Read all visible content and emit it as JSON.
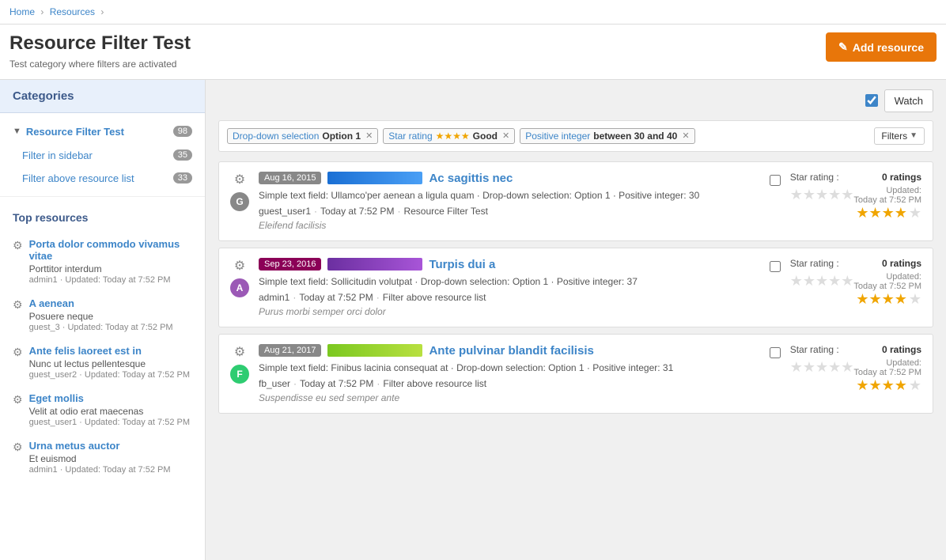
{
  "breadcrumb": {
    "home": "Home",
    "resources": "Resources",
    "current": ""
  },
  "page": {
    "title": "Resource Filter Test",
    "subtitle": "Test category where filters are activated",
    "add_resource_label": "Add resource"
  },
  "watch": {
    "label": "Watch"
  },
  "filters": {
    "label": "Filters",
    "tags": [
      {
        "key": "Drop-down selection",
        "value": "Option 1"
      },
      {
        "key": "Star rating",
        "value": "Good"
      },
      {
        "key": "Positive integer",
        "value": "between 30 and 40"
      }
    ]
  },
  "sidebar": {
    "categories_header": "Categories",
    "section": {
      "title": "Resource Filter Test",
      "count": 98
    },
    "items": [
      {
        "label": "Filter in sidebar",
        "count": 35
      },
      {
        "label": "Filter above resource list",
        "count": 33
      }
    ],
    "top_resources_header": "Top resources",
    "top_resources": [
      {
        "title": "Porta dolor commodo vivamus vitae",
        "subtitle": "Porttitor interdum",
        "meta": "admin1 · Updated: Today at 7:52 PM"
      },
      {
        "title": "A aenean",
        "subtitle": "Posuere neque",
        "meta": "guest_3 · Updated: Today at 7:52 PM"
      },
      {
        "title": "Ante felis laoreet est in",
        "subtitle": "Nunc ut lectus pellentesque",
        "meta": "guest_user2 · Updated: Today at 7:52 PM"
      },
      {
        "title": "Eget mollis",
        "subtitle": "Velit at odio erat maecenas",
        "meta": "guest_user1 · Updated: Today at 7:52 PM"
      },
      {
        "title": "Urna metus auctor",
        "subtitle": "Et euismod",
        "meta": "admin1 · Updated: Today at 7:52 PM"
      }
    ]
  },
  "resources": [
    {
      "date": "Aug 16, 2015",
      "date_style": "color-bar-blue",
      "date_bg": "#888",
      "avatar_letter": "G",
      "avatar_class": "avatar-g",
      "title": "Ac sagittis nec",
      "desc": "Simple text field: Ullamco'per aenean a ligula quam · Drop-down selection: Option 1 · Positive integer: 30",
      "user": "guest_user1",
      "time": "Today at 7:52 PM",
      "category": "Resource Filter Test",
      "footer": "Eleifend facilisis",
      "star_rating_label": "Star rating :",
      "stars_filled": 4,
      "stars_empty": 1,
      "ratings_count": "0 ratings",
      "updated_label": "Updated:",
      "updated_time": "Today at 7:52 PM"
    },
    {
      "date": "Sep 23, 2016",
      "date_style": "color-bar-purple",
      "date_bg": "#8b0057",
      "avatar_letter": "A",
      "avatar_class": "avatar-a",
      "title": "Turpis dui a",
      "desc": "Simple text field: Sollicitudin volutpat · Drop-down selection: Option 1 · Positive integer: 37",
      "user": "admin1",
      "time": "Today at 7:52 PM",
      "category": "Filter above resource list",
      "footer": "Purus morbi semper orci dolor",
      "star_rating_label": "Star rating :",
      "stars_filled": 4,
      "stars_empty": 1,
      "ratings_count": "0 ratings",
      "updated_label": "Updated:",
      "updated_time": "Today at 7:52 PM"
    },
    {
      "date": "Aug 21, 2017",
      "date_style": "color-bar-green",
      "date_bg": "#888",
      "avatar_letter": "F",
      "avatar_class": "avatar-f",
      "title": "Ante pulvinar blandit facilisis",
      "desc": "Simple text field: Finibus lacinia consequat at · Drop-down selection: Option 1 · Positive integer: 31",
      "user": "fb_user",
      "time": "Today at 7:52 PM",
      "category": "Filter above resource list",
      "footer": "Suspendisse eu sed semper ante",
      "star_rating_label": "Star rating :",
      "stars_filled": 4,
      "stars_empty": 1,
      "ratings_count": "0 ratings",
      "updated_label": "Updated:",
      "updated_time": "Today at 7:52 PM"
    }
  ]
}
